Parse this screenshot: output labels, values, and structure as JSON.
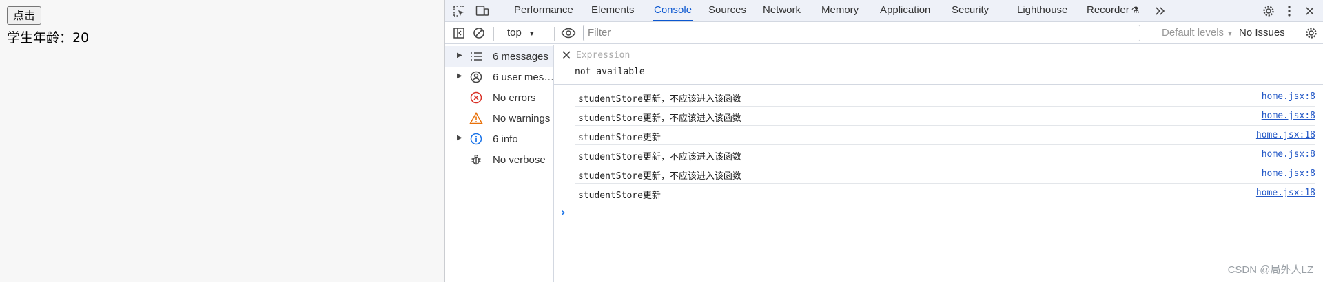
{
  "page": {
    "button_label": "点击",
    "age_text": "学生年龄：20"
  },
  "devtools": {
    "tabs": [
      "Performance",
      "Elements",
      "Console",
      "Sources",
      "Network",
      "Memory",
      "Application",
      "Security",
      "Lighthouse",
      "Recorder"
    ],
    "active_tab": "Console",
    "toolbar": {
      "context": "top",
      "filter_placeholder": "Filter",
      "levels": "Default levels",
      "issues": "No Issues"
    },
    "sidebar": [
      {
        "label": "6 messages",
        "icon": "list-icon",
        "expandable": true,
        "selected": true
      },
      {
        "label": "6 user mes…",
        "icon": "user-icon",
        "expandable": true
      },
      {
        "label": "No errors",
        "icon": "error-icon",
        "expandable": false
      },
      {
        "label": "No warnings",
        "icon": "warning-icon",
        "expandable": false
      },
      {
        "label": "6 info",
        "icon": "info-icon",
        "expandable": true
      },
      {
        "label": "No verbose",
        "icon": "bug-icon",
        "expandable": false
      }
    ],
    "expression": {
      "placeholder": "Expression",
      "value": "not available"
    },
    "messages": [
      {
        "text": "studentStore更新，不应该进入该函数",
        "source": "home.jsx:8"
      },
      {
        "text": "studentStore更新，不应该进入该函数",
        "source": "home.jsx:8"
      },
      {
        "text": "studentStore更新",
        "source": "home.jsx:18"
      },
      {
        "text": "studentStore更新，不应该进入该函数",
        "source": "home.jsx:8"
      },
      {
        "text": "studentStore更新，不应该进入该函数",
        "source": "home.jsx:8"
      },
      {
        "text": "studentStore更新",
        "source": "home.jsx:18"
      }
    ],
    "prompt_symbol": "›"
  },
  "watermark": "CSDN @局外人LZ",
  "colors": {
    "accent": "#0b57d0",
    "link": "#2459c7",
    "error": "#d93025",
    "warning": "#e8710a",
    "info": "#1a73e8"
  }
}
